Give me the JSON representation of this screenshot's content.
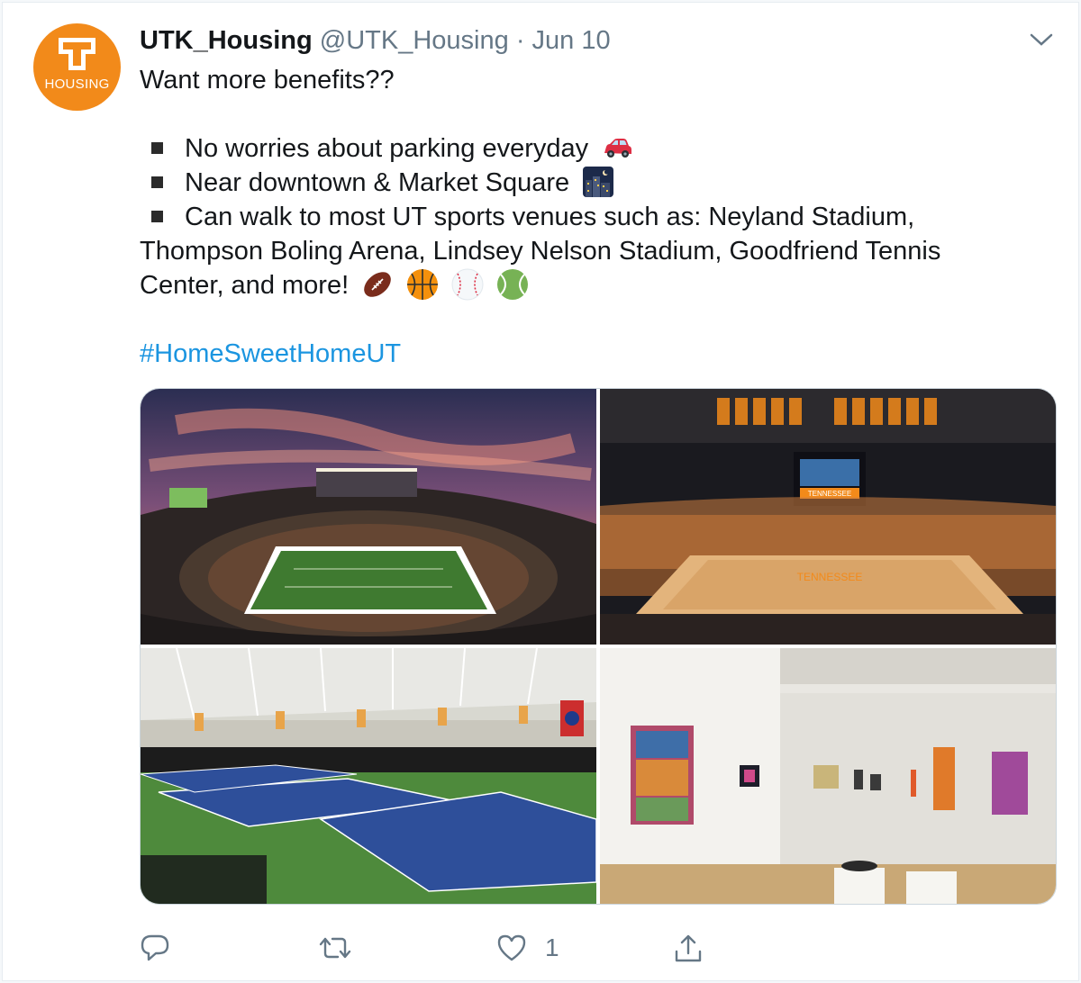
{
  "tweet": {
    "author_name": "UTK_Housing",
    "author_handle": "@UTK_Housing",
    "separator": "·",
    "date": "Jun 10",
    "avatar_text": "HOUSING",
    "lines": {
      "intro": "Want more benefits??",
      "bullet1": "No worries about parking everyday",
      "bullet2": "Near downtown & Market Square",
      "bullet3": "Can walk to most UT sports venues such as: Neyland Stadium,",
      "cont1": "Thompson Boling Arena, Lindsey Nelson Stadium, Goodfriend Tennis",
      "cont2": "Center, and more!"
    },
    "hashtag": "#HomeSweetHomeUT",
    "emojis": [
      "car",
      "night-city",
      "football",
      "basketball",
      "baseball",
      "tennis-ball"
    ],
    "photos": [
      "football-stadium-sunset",
      "basketball-arena",
      "indoor-tennis-center",
      "art-gallery"
    ],
    "photo_signage": {
      "arena_banner": "TENNESSEE",
      "court_lettering": "TENNESSEE"
    },
    "actions": {
      "reply_icon": "reply-icon",
      "retweet_icon": "retweet-icon",
      "like_icon": "heart-icon",
      "share_icon": "share-icon",
      "like_count": "1"
    },
    "colors": {
      "brand_orange": "#f28a1a",
      "link_blue": "#1b95e0",
      "secondary_text": "#657786"
    }
  }
}
